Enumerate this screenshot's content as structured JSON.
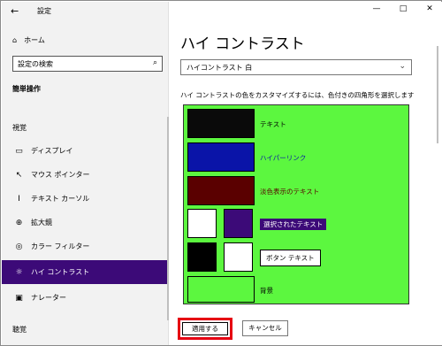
{
  "window": {
    "title": "設定",
    "controls": [
      "—",
      "□",
      "✕"
    ]
  },
  "sidebar": {
    "home": "ホーム",
    "search_placeholder": "設定の検索",
    "section": "簡単操作",
    "group_vision": "視覚",
    "items": [
      {
        "label": "ディスプレイ",
        "icon": "display-icon"
      },
      {
        "label": "マウス ポインター",
        "icon": "mouse-pointer-icon"
      },
      {
        "label": "テキスト カーソル",
        "icon": "text-cursor-icon"
      },
      {
        "label": "拡大鏡",
        "icon": "magnifier-icon"
      },
      {
        "label": "カラー フィルター",
        "icon": "color-filter-icon"
      },
      {
        "label": "ハイ コントラスト",
        "icon": "high-contrast-icon",
        "active": true
      },
      {
        "label": "ナレーター",
        "icon": "narrator-icon"
      }
    ],
    "group_hearing": "聴覚"
  },
  "main": {
    "title": "ハイ コントラスト",
    "theme_value": "ハイコントラスト 白",
    "description": "ハイ コントラストの色をカスタマイズするには、色付きの四角形を選択します",
    "preview": {
      "background_color": "#5cf73f",
      "rows": [
        {
          "label": "テキスト",
          "color": "#0a0a0a",
          "label_color": "#000000"
        },
        {
          "label": "ハイパーリンク",
          "color": "#0a14a8",
          "label_color": "#0a14a8"
        },
        {
          "label": "淡色表示のテキスト",
          "color": "#5a0000",
          "label_color": "#5a0000"
        },
        {
          "label": "選択されたテキスト",
          "colors": [
            "#ffffff",
            "#3c0a78"
          ]
        },
        {
          "label": "ボタン テキスト",
          "colors": [
            "#000000",
            "#ffffff"
          ]
        },
        {
          "label": "背景",
          "color": "#5cf73f"
        }
      ]
    },
    "apply_label": "適用する",
    "cancel_label": "キャンセル",
    "highlight_color": "#e60012"
  }
}
